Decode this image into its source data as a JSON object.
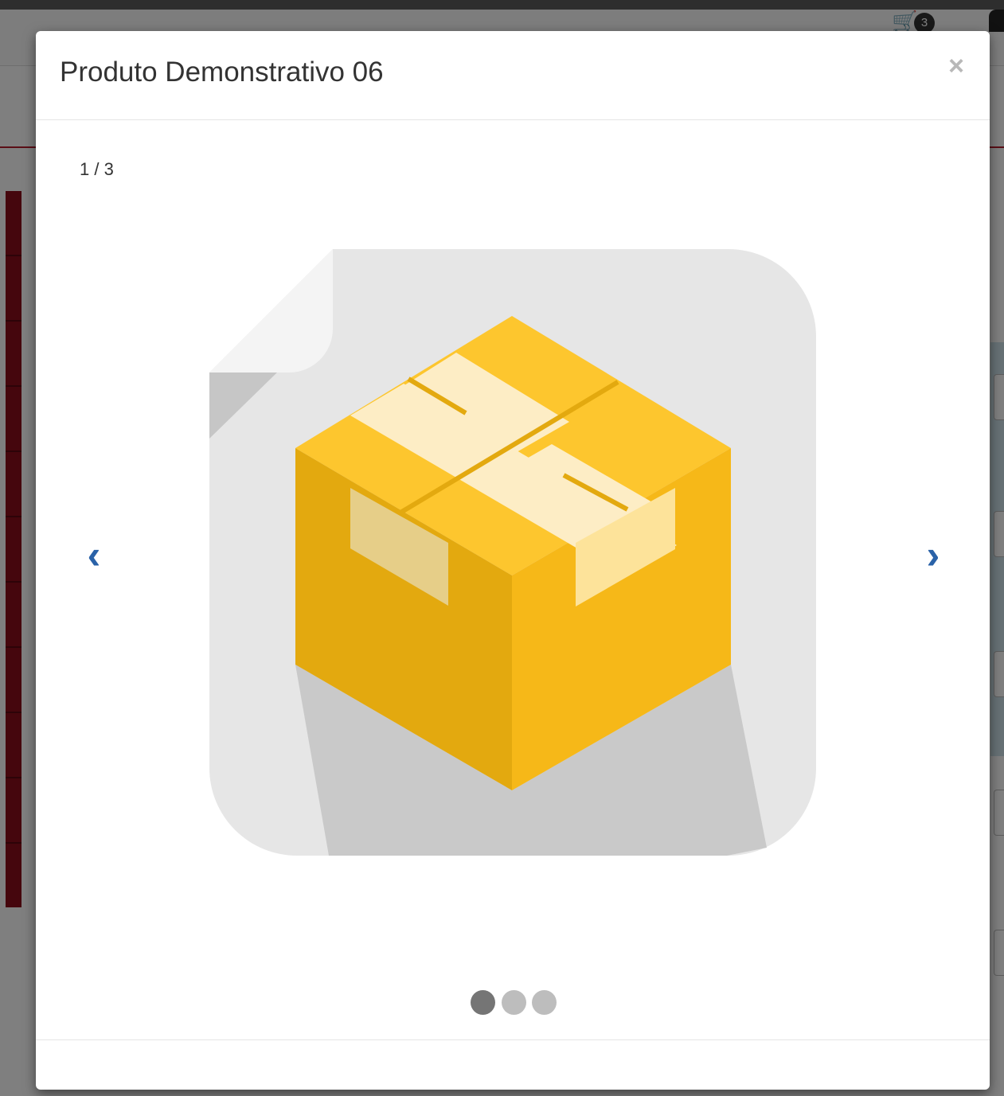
{
  "background": {
    "cart_icon": "shopping-cart-icon",
    "cart_count": "3",
    "brand_color": "#8b0d1b"
  },
  "modal": {
    "title": "Produto Demonstrativo 06",
    "close_label": "×",
    "counter": "1 / 3",
    "prev_label": "‹",
    "next_label": "›",
    "product_image_icon": "package-box-icon",
    "dots": [
      {
        "active": true
      },
      {
        "active": false
      },
      {
        "active": false
      }
    ],
    "accent_color": "#2a62a8"
  }
}
